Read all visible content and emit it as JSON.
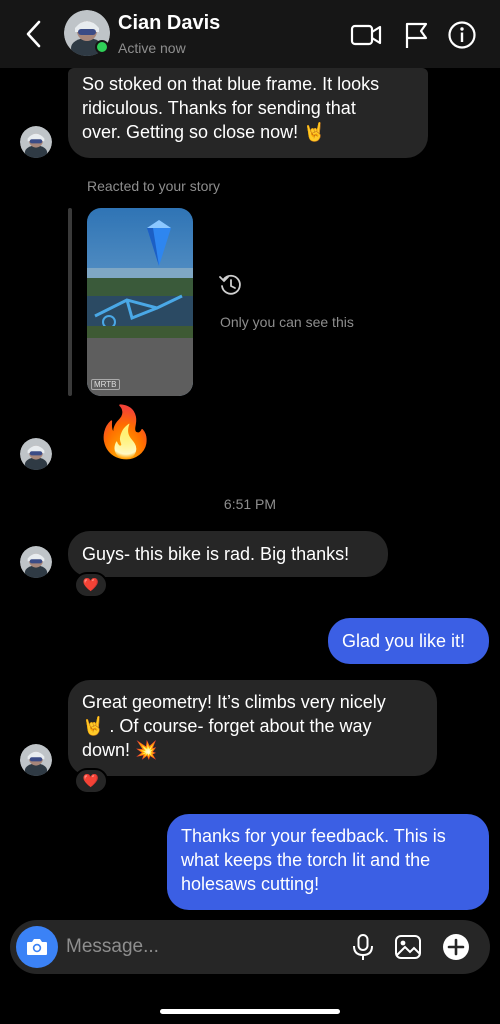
{
  "header": {
    "name": "Cian Davis",
    "status": "Active now"
  },
  "messages": {
    "m1": [
      "So stoked on that blue frame. It looks",
      "ridiculous. Thanks for sending that",
      "over. Getting so close now! 🤘"
    ],
    "story_caption": "Reacted to your story",
    "story_tag": "MRTB",
    "story_note": "Only you can see this",
    "story_emoji": "🔥",
    "timestamp": "6:51 PM",
    "m2": "Guys- this bike is rad. Big thanks!",
    "m2_reaction": "❤️",
    "m3_out": "Glad you like it!",
    "m4": [
      "Great geometry! It’s climbs very nicely",
      "🤘 . Of course- forget about the way",
      "down! 💥"
    ],
    "m4_reaction": "❤️",
    "m5_out": [
      "Thanks for your feedback. This is",
      "what keeps the torch lit and the",
      "holesaws cutting!"
    ]
  },
  "composer": {
    "placeholder": "Message..."
  },
  "colors": {
    "background": "#000000",
    "incoming_bubble": "#262626",
    "outgoing_bubble": "#3b5fe4",
    "online_dot": "#2fd158",
    "camera_button": "#3b82f6"
  },
  "icons": [
    "back-chevron-icon",
    "video-call-icon",
    "flag-icon",
    "info-icon",
    "replay-icon",
    "camera-icon",
    "microphone-icon",
    "gallery-icon",
    "add-icon"
  ]
}
